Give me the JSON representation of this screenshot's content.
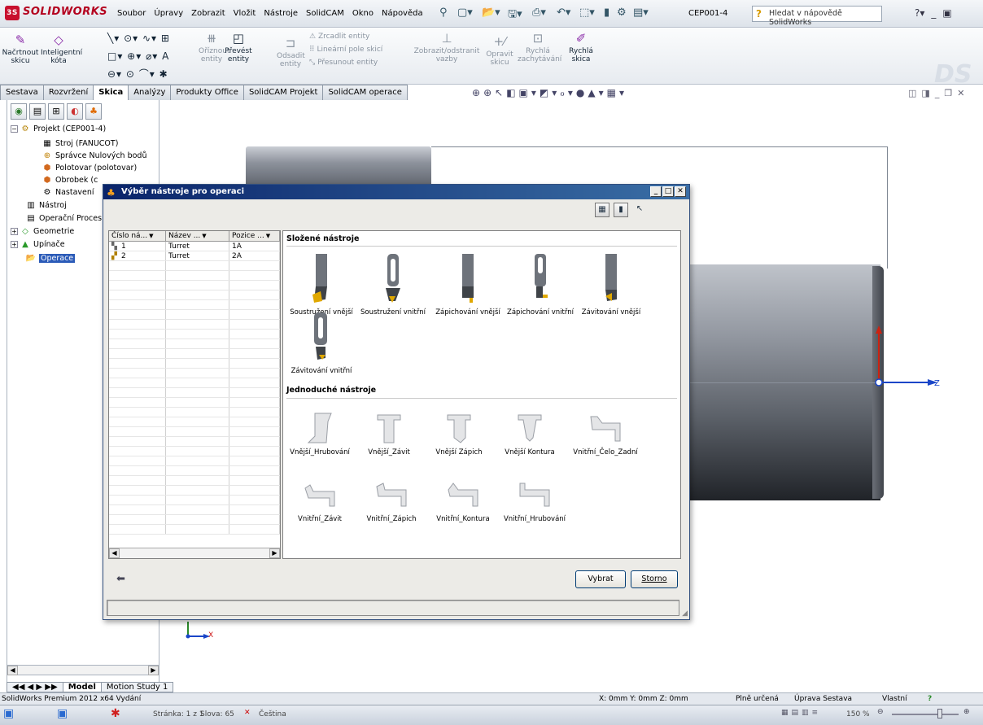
{
  "app": {
    "logo": "SOLIDWORKS",
    "menu": [
      "Soubor",
      "Úpravy",
      "Zobrazit",
      "Vložit",
      "Nástroje",
      "SolidCAM",
      "Okno",
      "Nápověda"
    ],
    "document_title": "CEP001-4",
    "help_search_placeholder": "Hledat v nápovědě SolidWorks"
  },
  "commands": {
    "sketch": "Načrtnout skicu",
    "smart_dim": "Inteligentní kóta",
    "trim": "Oříznout entity",
    "convert": "Převést entity",
    "offset": "Odsadit entity",
    "mirror": "Zrcadlit entity",
    "linear_pattern": "Lineární pole skicí",
    "move": "Přesunout entity",
    "relations": "Zobrazit/odstranit vazby",
    "repair": "Opravit skicu",
    "snaps": "Rychlá zachytávání",
    "rapid": "Rychlá skica"
  },
  "tabs": [
    "Sestava",
    "Rozvržení",
    "Skica",
    "Analýzy",
    "Produkty Office",
    "SolidCAM Projekt",
    "SolidCAM operace"
  ],
  "active_tab": "Skica",
  "tree": {
    "project": "Projekt (CEP001-4)",
    "machine": "Stroj (FANUCOT)",
    "zero_manager": "Správce Nulových bodů",
    "stock": "Polotovar (polotovar)",
    "workpiece": "Obrobek (c",
    "settings": "Nastavení",
    "tool": "Nástroj",
    "process": "Operační Proces",
    "geometry": "Geometrie",
    "fixtures": "Upínače",
    "operations": "Operace"
  },
  "dialog": {
    "title": "Výběr nástroje pro operaci",
    "columns": [
      "Číslo ná...",
      "Název ...",
      "Pozice ..."
    ],
    "rows": [
      {
        "num": "1",
        "name": "Turret",
        "pos": "1A"
      },
      {
        "num": "2",
        "name": "Turret",
        "pos": "2A"
      }
    ],
    "group_composite": "Složené nástroje",
    "composite_tools": [
      "Soustružení vnější",
      "Soustružení vnitřní",
      "Zápichování vnější",
      "Zápichování vnitřní",
      "Závitování vnější",
      "Závitování vnitřní"
    ],
    "group_simple": "Jednoduché nástroje",
    "simple_tools": [
      "Vnější_Hrubování",
      "Vnější_Závit",
      "Vnější Zápich",
      "Vnější Kontura",
      "Vnitřní_Čelo_Zadní",
      "Vnitřní_Závit",
      "Vnitřní_Zápich",
      "Vnitřní_Kontura",
      "Vnitřní_Hrubování"
    ],
    "select_button": "Vybrat",
    "cancel_button": "Storno"
  },
  "graphics": {
    "axis_z": "Z",
    "axis_x": "X"
  },
  "bottom": {
    "model_tab": "Model",
    "motion_tab": "Motion Study 1",
    "status_left": "SolidWorks Premium 2012 x64 Vydání",
    "coords": "X: 0mm Y: 0mm Z: 0mm",
    "defined": "Plně určená",
    "edit_mode": "Úprava Sestava",
    "custom": "Vlastní",
    "taskbar_page": "Stránka: 1 z 1",
    "taskbar_words": "Slova: 65",
    "taskbar_lang": "Čeština",
    "zoom": "150 %"
  }
}
